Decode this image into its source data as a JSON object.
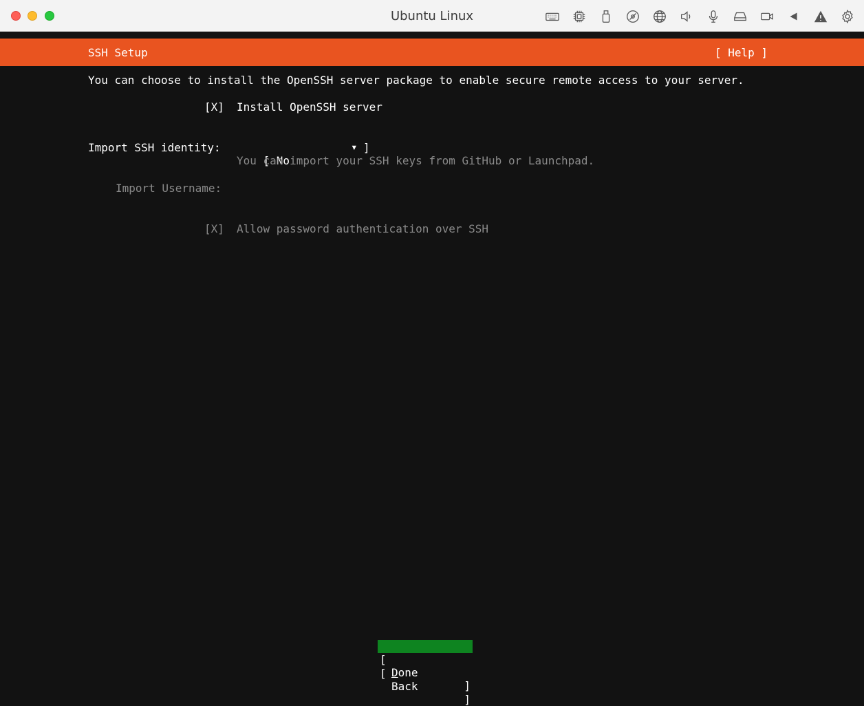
{
  "window": {
    "title": "Ubuntu Linux",
    "toolbar_icons": [
      "keyboard-icon",
      "cpu-icon",
      "usb-icon",
      "disc-icon",
      "globe-icon",
      "speaker-icon",
      "microphone-icon",
      "drive-icon",
      "camera-icon",
      "back-arrow-icon",
      "warning-icon",
      "settings-gear-icon"
    ]
  },
  "header": {
    "title": "SSH Setup",
    "help": "[ Help ]"
  },
  "main": {
    "description": "You can choose to install the OpenSSH server package to enable secure remote access to your server.",
    "install_ssh": {
      "checkbox": "[X]",
      "label": "Install OpenSSH server"
    },
    "import_identity": {
      "label": "Import SSH identity:",
      "select_open": "[ ",
      "select_value": "No",
      "select_arrow": "▾",
      "select_close": "]",
      "hint": "You can import your SSH keys from GitHub or Launchpad."
    },
    "import_username": {
      "label": "Import Username:"
    },
    "password_auth": {
      "checkbox": "[X]",
      "label": "Allow password authentication over SSH"
    }
  },
  "buttons": {
    "open": "[",
    "close": "]",
    "done": "Done",
    "back": "Back"
  },
  "colors": {
    "header_bg": "#e95420",
    "done_bg": "#0e8420",
    "screen_bg": "#121212"
  }
}
